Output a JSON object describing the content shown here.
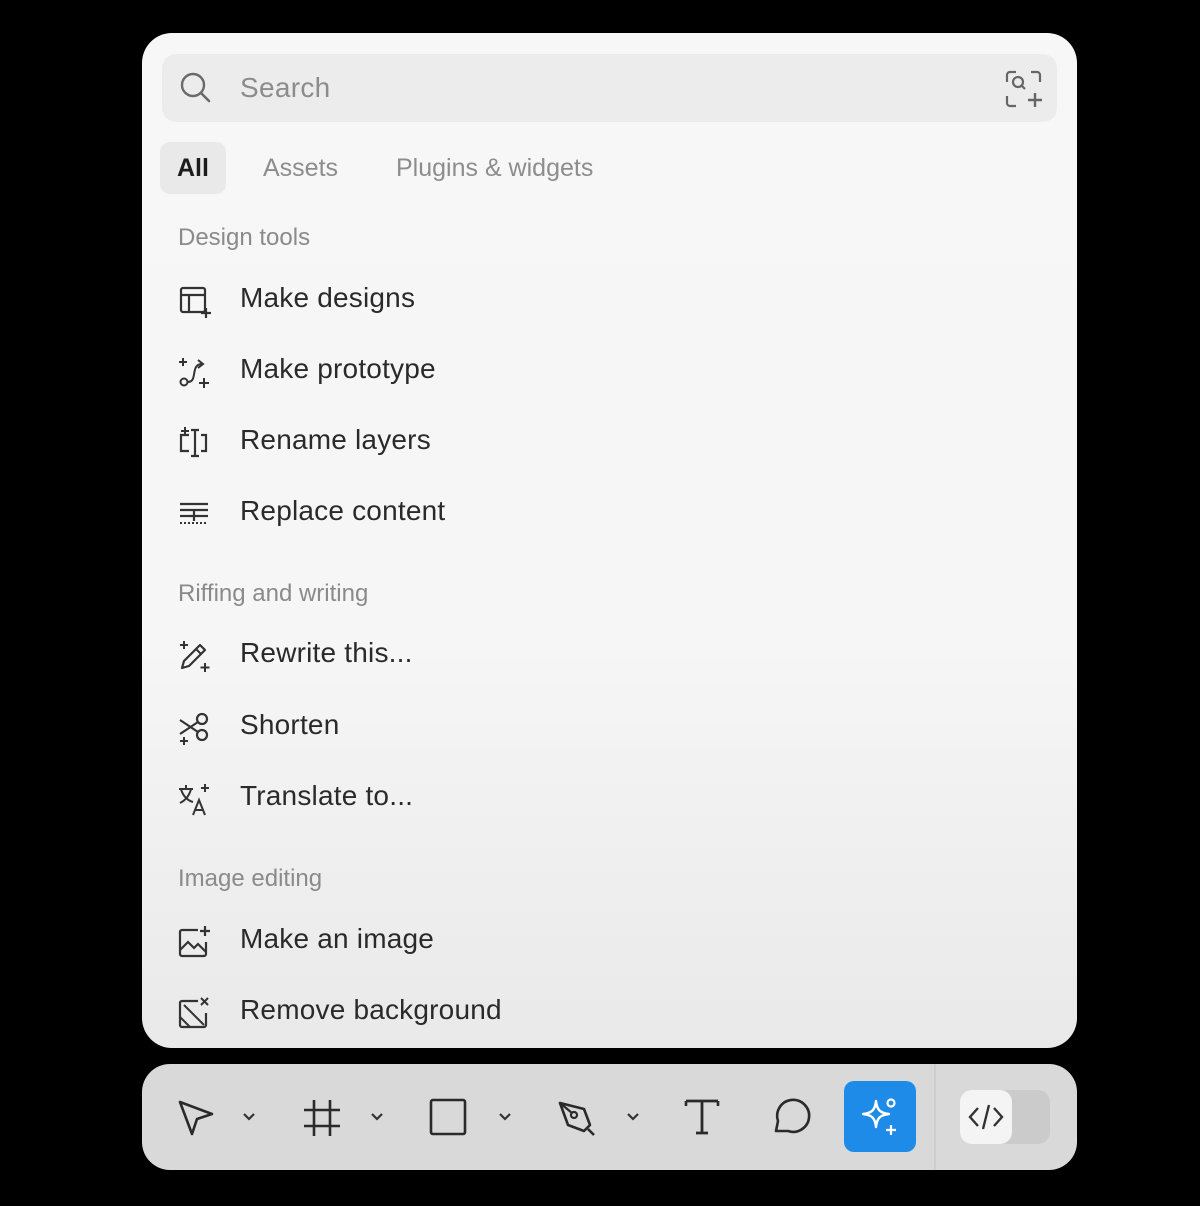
{
  "search": {
    "placeholder": "Search",
    "icon": "search-icon",
    "action_icon": "scan-ai-icon"
  },
  "tabs": [
    {
      "label": "All",
      "active": true
    },
    {
      "label": "Assets",
      "active": false
    },
    {
      "label": "Plugins & widgets",
      "active": false
    }
  ],
  "sections": [
    {
      "title": "Design tools",
      "items": [
        {
          "label": "Make designs",
          "icon": "make-designs-icon"
        },
        {
          "label": "Make prototype",
          "icon": "make-prototype-icon"
        },
        {
          "label": "Rename layers",
          "icon": "rename-layers-icon"
        },
        {
          "label": "Replace content",
          "icon": "replace-content-icon"
        }
      ]
    },
    {
      "title": "Riffing and writing",
      "items": [
        {
          "label": "Rewrite this...",
          "icon": "rewrite-icon"
        },
        {
          "label": "Shorten",
          "icon": "shorten-icon"
        },
        {
          "label": "Translate to...",
          "icon": "translate-icon"
        }
      ]
    },
    {
      "title": "Image editing",
      "items": [
        {
          "label": "Make an image",
          "icon": "make-image-icon"
        },
        {
          "label": "Remove background",
          "icon": "remove-background-icon"
        }
      ]
    }
  ],
  "toolbar": {
    "tools": [
      "move-tool",
      "frame-tool",
      "shape-tool",
      "pen-tool",
      "text-tool",
      "comment-tool",
      "ai-actions-tool",
      "dev-mode-toggle"
    ],
    "active_tool": "ai-actions-tool",
    "accent_color": "#1f8be8"
  }
}
